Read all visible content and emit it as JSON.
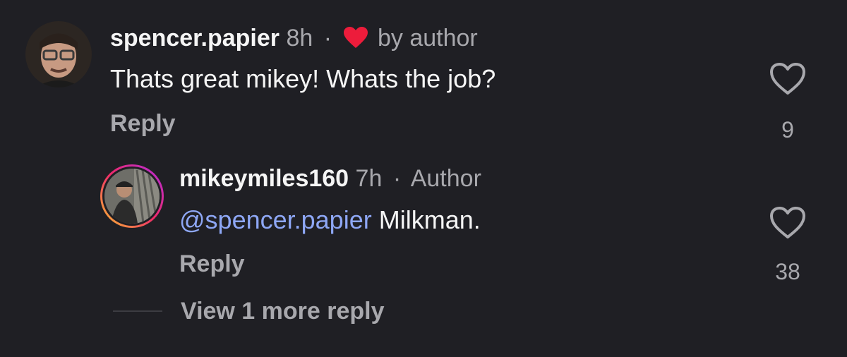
{
  "comments": [
    {
      "username": "spencer.papier",
      "time": "8h",
      "separator": "·",
      "liked_by_label": "by author",
      "liked_icon": "heart-filled-icon",
      "body": "Thats great mikey! Whats the job?",
      "reply_label": "Reply",
      "like_count": "9",
      "avatar_icon": "avatar-photo"
    },
    {
      "username": "mikeymiles160",
      "time": "7h",
      "separator": "·",
      "author_label": "Author",
      "mention": "@spencer.papier",
      "body": "Milkman.",
      "reply_label": "Reply",
      "like_count": "38",
      "avatar_icon": "avatar-photo-story-ring"
    }
  ],
  "view_more_label": "View 1 more reply",
  "colors": {
    "background": "#1f1f24",
    "text": "#f5f5f5",
    "muted": "#a8a8ad",
    "mention": "#8ea7f5",
    "heart_red": "#ed1c3b"
  }
}
